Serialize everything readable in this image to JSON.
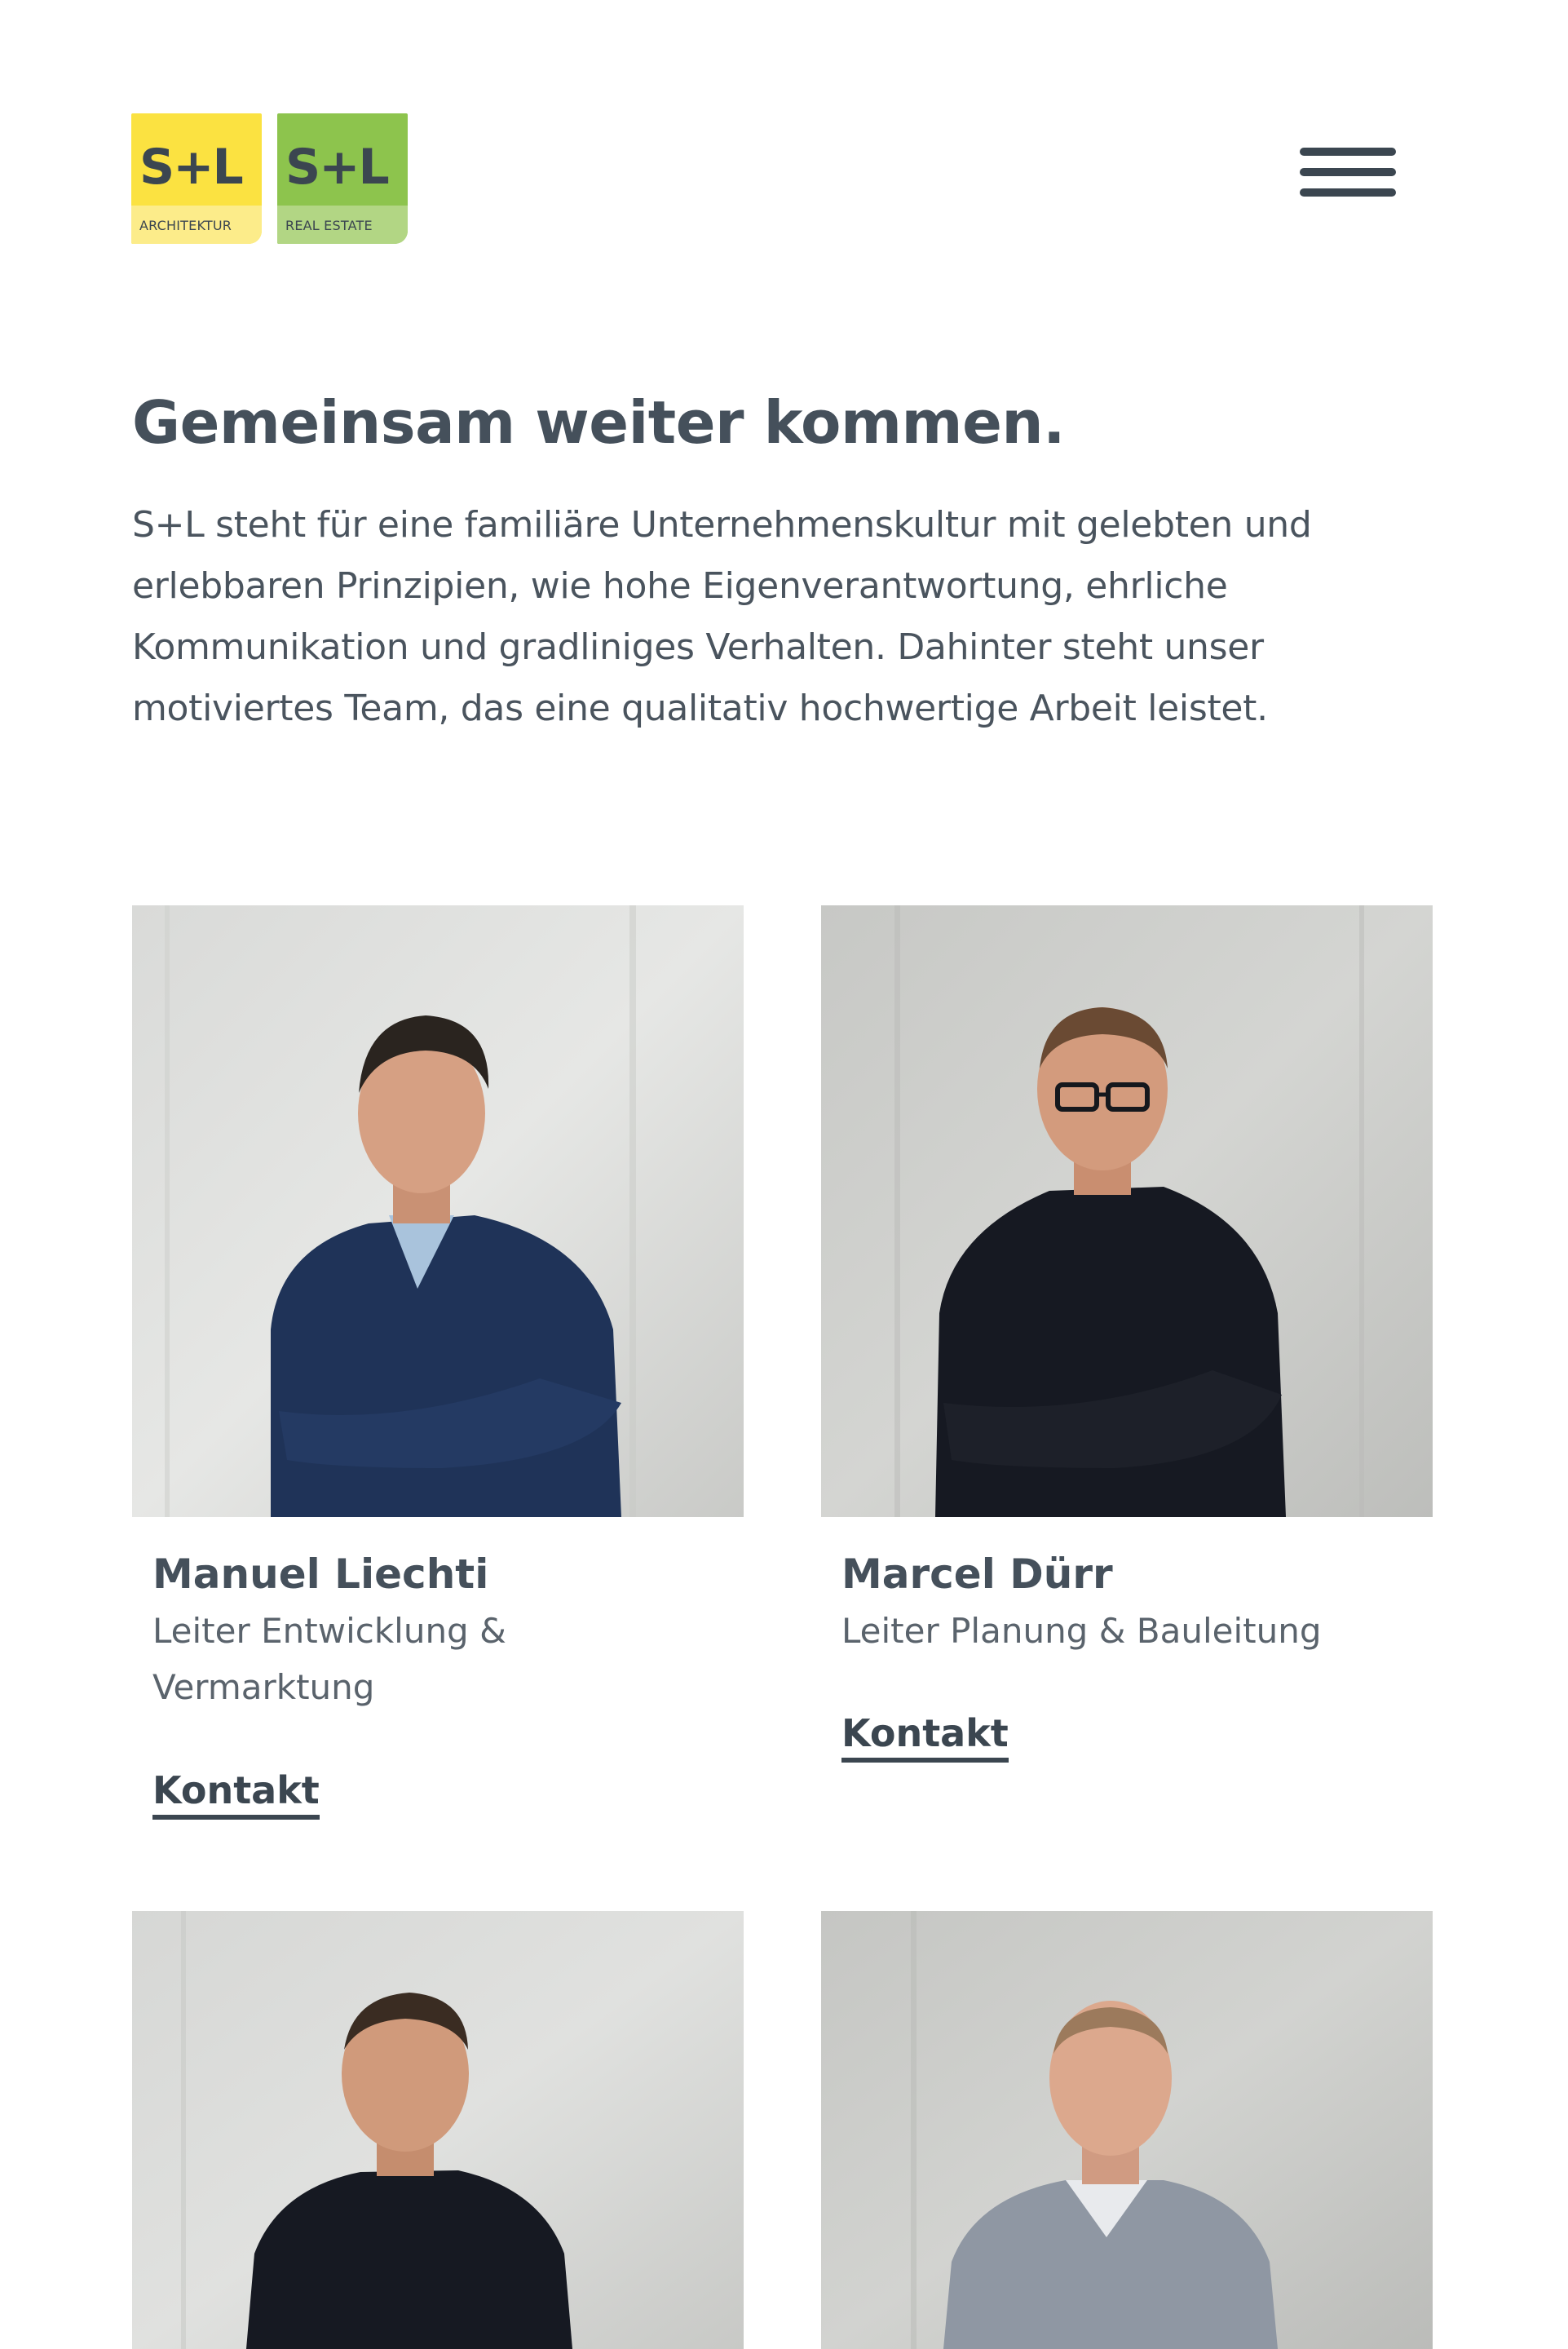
{
  "header": {
    "logos": [
      {
        "mark": "S+L",
        "subtitle": "ARCHITEKTUR",
        "color": "#fbe241"
      },
      {
        "mark": "S+L",
        "subtitle": "REAL ESTATE",
        "color": "#8dc44d"
      }
    ],
    "menu_icon": "hamburger-menu-icon"
  },
  "intro": {
    "headline": "Gemeinsam weiter kommen.",
    "text": "S+L steht für eine familiäre Unternehmenskultur mit gelebten und erlebbaren Prinzipien, wie hohe Eigenverantwortung, ehrliche Kommunikation und gradliniges Verhalten. Dahinter steht unser motiviertes Team, das eine qualitativ hochwertige Arbeit leistet."
  },
  "team": [
    {
      "name": "Manuel Liechti",
      "role": "Leiter Entwicklung & Vermarktung",
      "contact": "Kontakt"
    },
    {
      "name": "Marcel Dürr",
      "role": "Leiter Planung & Bauleitung",
      "contact": "Kontakt"
    },
    {
      "name": "",
      "role": "",
      "contact": ""
    },
    {
      "name": "",
      "role": "",
      "contact": ""
    }
  ],
  "colors": {
    "text": "#45505b",
    "logo_yellow": "#fbe241",
    "logo_green": "#8dc44d",
    "photo_background": "#cfd0cd"
  }
}
